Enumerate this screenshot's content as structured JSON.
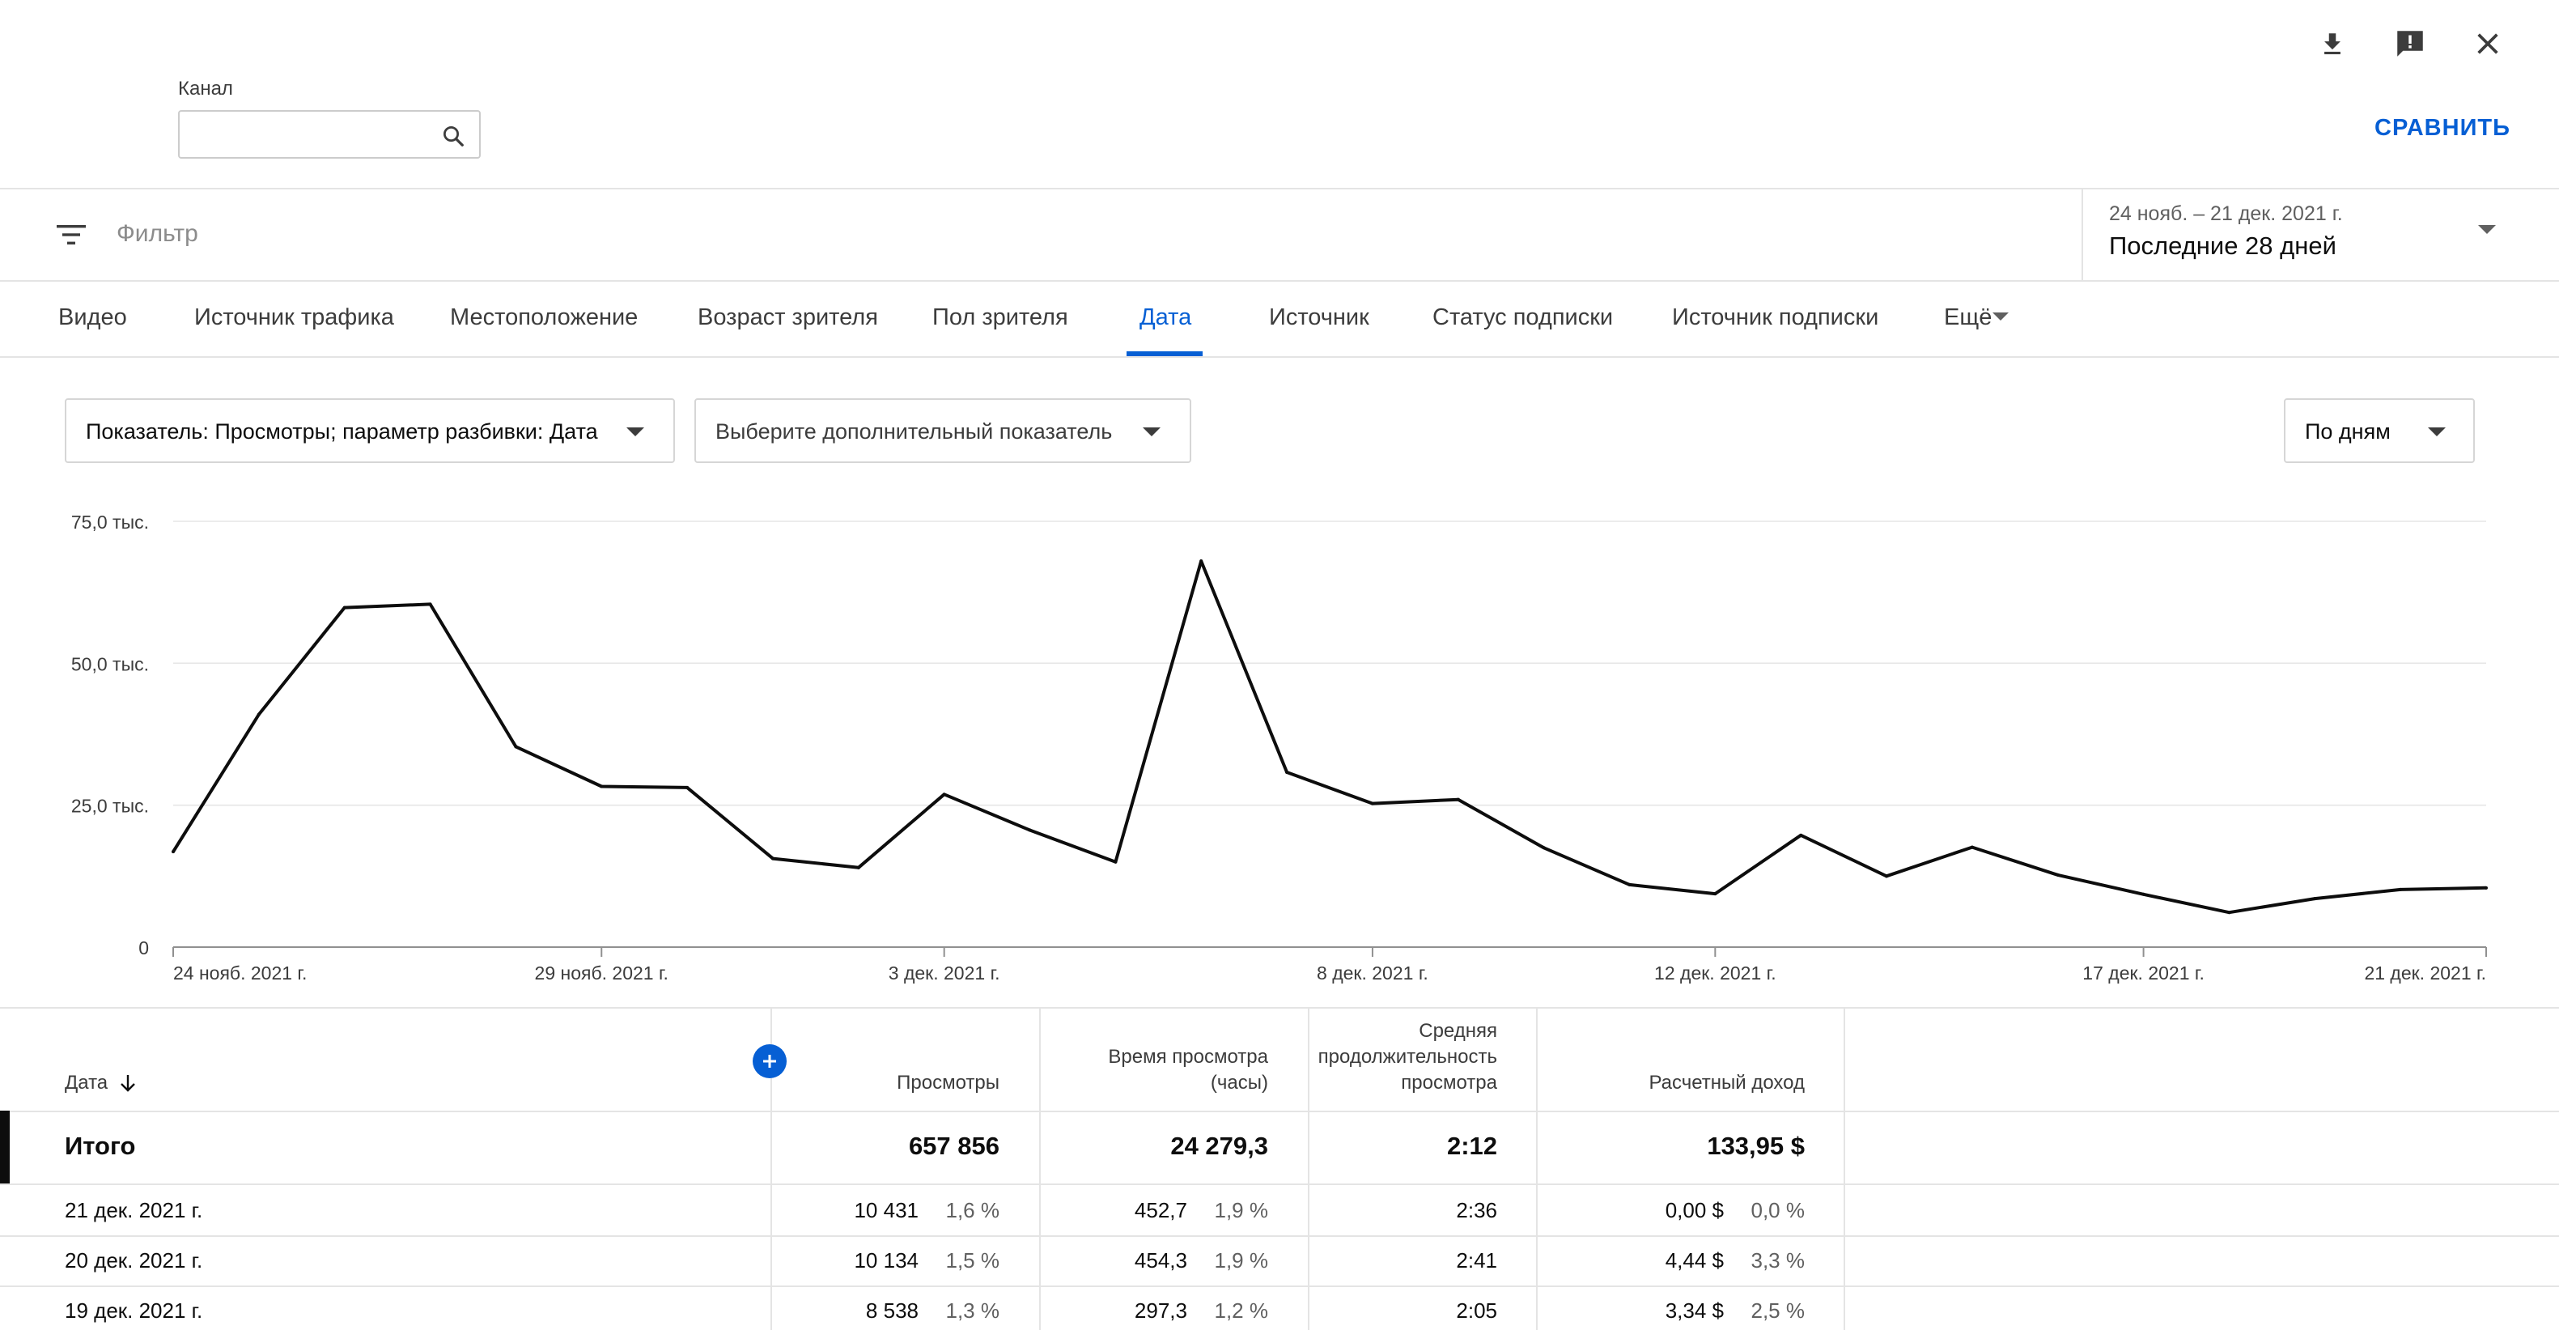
{
  "header": {
    "channel_label": "Канал",
    "channel_search_value": "",
    "compare_label": "СРАВНИТЬ",
    "icons": [
      "download-icon",
      "feedback-icon",
      "close-icon",
      "search-icon"
    ]
  },
  "filter": {
    "label": "Фильтр",
    "date_range_sub": "24 нояб. – 21 дек. 2021 г.",
    "date_range_main": "Последние 28 дней"
  },
  "tabs": [
    {
      "label": "Видео"
    },
    {
      "label": "Источник трафика"
    },
    {
      "label": "Местоположение"
    },
    {
      "label": "Возраст зрителя"
    },
    {
      "label": "Пол зрителя"
    },
    {
      "label": "Дата",
      "active": true
    },
    {
      "label": "Источник"
    },
    {
      "label": "Статус подписки"
    },
    {
      "label": "Источник подписки"
    },
    {
      "label": "Ещё"
    }
  ],
  "controls": {
    "metric_dropdown": "Показатель: Просмотры; параметр разбивки: Дата",
    "extra_metric_dropdown": "Выберите дополнительный показатель",
    "period_dropdown": "По дням"
  },
  "chart_data": {
    "type": "line",
    "y_tick_labels": [
      "0",
      "25,0 тыс.",
      "50,0 тыс.",
      "75,0 тыс."
    ],
    "y_ticks": [
      0,
      25000,
      50000,
      75000
    ],
    "ylim": [
      0,
      75000
    ],
    "x_tick_labels": [
      "24 нояб. 2021 г.",
      "29 нояб. 2021 г.",
      "3 дек. 2021 г.",
      "8 дек. 2021 г.",
      "12 дек. 2021 г.",
      "17 дек. 2021 г.",
      "21 дек. 2021 г."
    ],
    "x_tick_indices": [
      0,
      5,
      9,
      14,
      18,
      23,
      27
    ],
    "x": [
      "24 нояб.",
      "25 нояб.",
      "26 нояб.",
      "27 нояб.",
      "28 нояб.",
      "29 нояб.",
      "30 нояб.",
      "1 дек.",
      "2 дек.",
      "3 дек.",
      "4 дек.",
      "5 дек.",
      "6 дек.",
      "7 дек.",
      "8 дек.",
      "9 дек.",
      "10 дек.",
      "11 дек.",
      "12 дек.",
      "13 дек.",
      "14 дек.",
      "15 дек.",
      "16 дек.",
      "17 дек.",
      "18 дек.",
      "19 дек.",
      "20 дек.",
      "21 дек."
    ],
    "series": [
      {
        "values": [
          16800,
          41000,
          59800,
          60400,
          35300,
          28300,
          28100,
          15600,
          14000,
          26900,
          20600,
          15000,
          68000,
          30800,
          25300,
          26000,
          17500,
          11000,
          9400,
          19700,
          12500,
          17600,
          12700,
          9300,
          6100,
          8538,
          10134,
          10431
        ]
      }
    ],
    "grid": true,
    "legend": "none",
    "line_color": "#0d0d0d"
  },
  "table": {
    "headers": {
      "date": "Дата",
      "views": "Просмотры",
      "watch_time": [
        "Время просмотра",
        "(часы)"
      ],
      "avg_duration": [
        "Средняя",
        "продолжительность",
        "просмотра"
      ],
      "revenue": "Расчетный доход"
    },
    "total": {
      "label": "Итого",
      "views": "657 856",
      "watch_time": "24 279,3",
      "avg_duration": "2:12",
      "revenue": "133,95 $"
    },
    "rows": [
      {
        "date": "21 дек. 2021 г.",
        "views": "10 431",
        "views_pct": "1,6 %",
        "watch_time": "452,7",
        "watch_pct": "1,9 %",
        "avg_duration": "2:36",
        "revenue": "0,00 $",
        "revenue_pct": "0,0 %"
      },
      {
        "date": "20 дек. 2021 г.",
        "views": "10 134",
        "views_pct": "1,5 %",
        "watch_time": "454,3",
        "watch_pct": "1,9 %",
        "avg_duration": "2:41",
        "revenue": "4,44 $",
        "revenue_pct": "3,3 %"
      },
      {
        "date": "19 дек. 2021 г.",
        "views": "8 538",
        "views_pct": "1,3 %",
        "watch_time": "297,3",
        "watch_pct": "1,2 %",
        "avg_duration": "2:05",
        "revenue": "3,34 $",
        "revenue_pct": "2,5 %"
      }
    ]
  }
}
